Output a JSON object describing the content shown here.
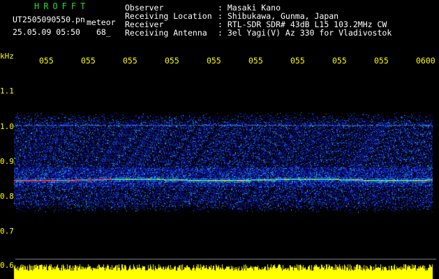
{
  "header": {
    "logo": "HROFFT",
    "filename": "UT2505090550.pn",
    "mode": "meteor",
    "datetime": "25.05.09 05:50",
    "count": "68_"
  },
  "info": {
    "labels": [
      "Observer",
      "Receiving Location",
      "Receiver",
      "Receiving Antenna"
    ],
    "values": [
      ": Masaki Kano",
      ": Shibukawa, Gunma, Japan",
      ": RTL-SDR SDR# 43dB L15 103.2MHz CW",
      ": 3el Yagi(V) Az 330 for Vladivostok"
    ]
  },
  "yaxis": {
    "unit": "kHz",
    "ticks": [
      "1.1",
      "1.0",
      "0.9",
      "0.8",
      "0.7",
      "0.6"
    ]
  },
  "xaxis": {
    "ticks": [
      "055",
      "055",
      "055",
      "055",
      "055",
      "055",
      "055",
      "055",
      "055",
      "0600"
    ]
  },
  "colors": {
    "background": "#000000",
    "label": "#ffff00",
    "logo": "#22e022",
    "text": "#ffffff"
  }
}
